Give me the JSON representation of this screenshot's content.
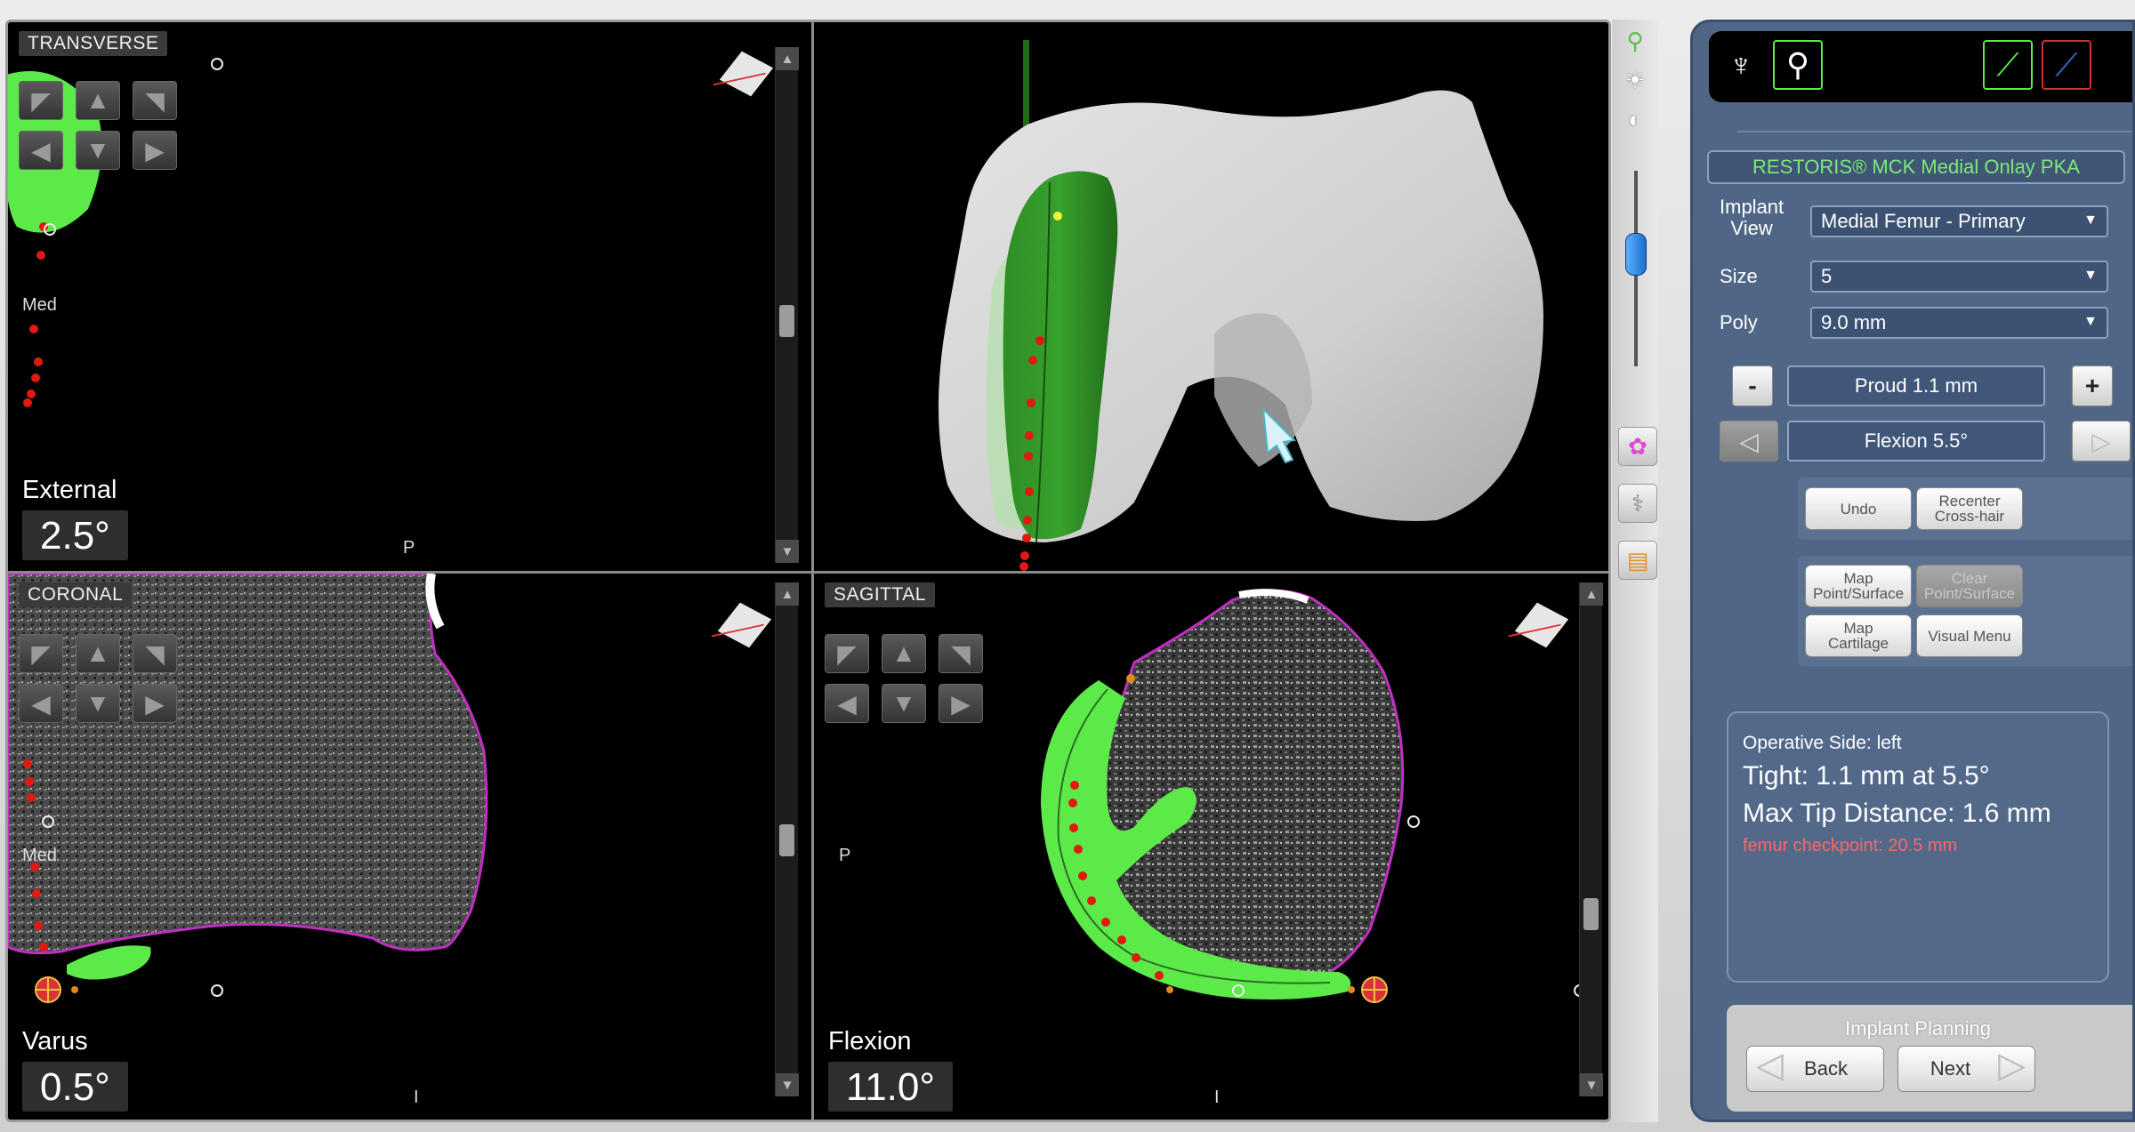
{
  "viewer": {
    "transverse": {
      "label": "TRANSVERSE",
      "side_label": "Med",
      "posterior_label": "P",
      "angle_label": "External",
      "angle_value": "2.5°"
    },
    "coronal": {
      "label": "CORONAL",
      "side_label": "Med",
      "inferior_label": "I",
      "angle_label": "Varus",
      "angle_value": "0.5°"
    },
    "sagittal": {
      "label": "SAGITTAL",
      "posterior_label": "P",
      "inferior_label": "I",
      "angle_label": "Flexion",
      "angle_value": "11.0°"
    },
    "nav_arrows": [
      "◤",
      "▲",
      "◥",
      "◀",
      "▼",
      "▶"
    ],
    "colors": {
      "implant_green": "#5bea48",
      "implant_dark_green": "#2e8a23",
      "bone_outline": "#c02fc0",
      "checkpoint_red": "#e01a10",
      "bone_white": "#d5d5d5"
    }
  },
  "toolstrip": {
    "icons": [
      "magnifier-icon",
      "brightness-icon",
      "contrast-icon",
      "color-model-icon",
      "knee-icon",
      "ruler-icon"
    ]
  },
  "panel": {
    "implant_title": "RESTORIS® MCK Medial Onlay PKA",
    "implant_view_label": "Implant\nView",
    "implant_view_value": "Medial Femur - Primary",
    "size_label": "Size",
    "size_value": "5",
    "poly_label": "Poly",
    "poly_value": "9.0 mm",
    "proud_value": "Proud 1.1 mm",
    "minus_label": "-",
    "plus_label": "+",
    "flexion_value": "Flexion 5.5°",
    "undo_label": "Undo",
    "recenter_label": "Recenter\nCross-hair",
    "map_point_label": "Map\nPoint/Surface",
    "clear_point_label": "Clear\nPoint/Surface",
    "map_cartilage_label": "Map\nCartilage",
    "visual_menu_label": "Visual Menu",
    "status": {
      "operative_side": "Operative Side: left",
      "tight": "Tight: 1.1 mm at 5.5°",
      "max_tip": "Max Tip Distance: 1.6 mm",
      "checkpoint": "femur checkpoint: 20.5 mm"
    },
    "footer_title": "Implant Planning",
    "back_label": "Back",
    "next_label": "Next"
  }
}
